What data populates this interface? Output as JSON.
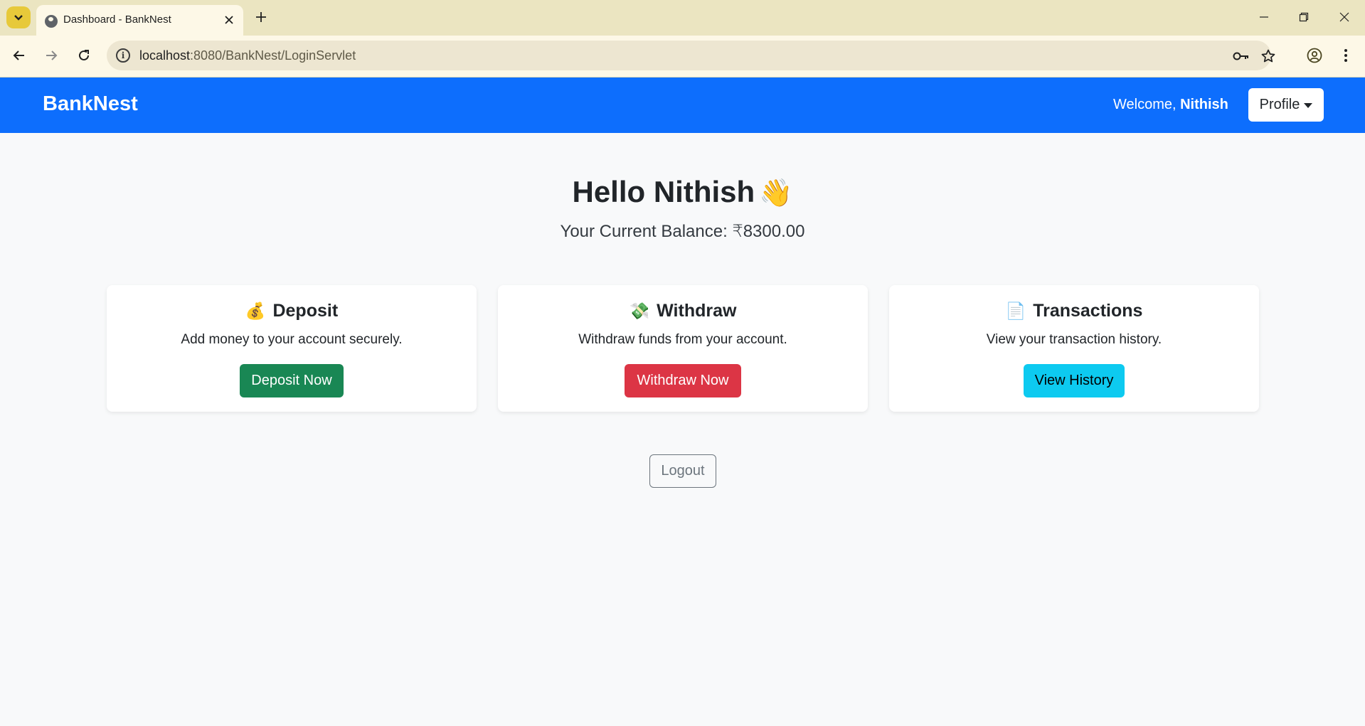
{
  "browser": {
    "tab_title": "Dashboard - BankNest",
    "url_host": "localhost",
    "url_rest": ":8080/BankNest/LoginServlet",
    "icons": [
      "tab-search-icon",
      "globe-icon",
      "close-icon",
      "plus-icon",
      "minimize-icon",
      "restore-icon",
      "close-window-icon",
      "back-arrow-icon",
      "forward-arrow-icon",
      "reload-icon",
      "info-icon",
      "key-icon",
      "star-icon",
      "profile-icon",
      "more-icon"
    ]
  },
  "navbar": {
    "brand": "BankNest",
    "welcome_prefix": "Welcome, ",
    "user_name": "Nithish",
    "profile_label": "Profile",
    "color": "#0d6efd"
  },
  "main": {
    "greeting": "Hello Nithish",
    "greeting_emoji": "👋",
    "balance_text": "Your Current Balance: ₹8300.00"
  },
  "cards": [
    {
      "emoji": "💰",
      "title": "Deposit",
      "text": "Add money to your account securely.",
      "button": "Deposit Now",
      "color": "#198754"
    },
    {
      "emoji": "💸",
      "title": "Withdraw",
      "text": "Withdraw funds from your account.",
      "button": "Withdraw Now",
      "color": "#dc3545"
    },
    {
      "emoji": "📄",
      "title": "Transactions",
      "text": "View your transaction history.",
      "button": "View History",
      "color": "#0dcaf0"
    }
  ],
  "logout_label": "Logout"
}
